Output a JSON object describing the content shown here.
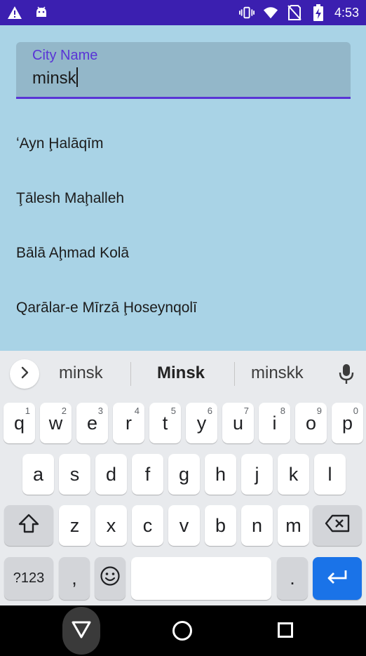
{
  "status_bar": {
    "time": "4:53",
    "icons_left": [
      "warning-icon",
      "android-icon"
    ],
    "icons_right": [
      "vibrate-icon",
      "wifi-icon",
      "no-sim-icon",
      "battery-charging-icon"
    ]
  },
  "city_input": {
    "label": "City Name",
    "value": "minsk"
  },
  "suggestions": [
    "ʻAyn Ḩalāqīm",
    "Ţālesh Maḩalleh",
    "Bālā Aḩmad Kolā",
    "Qarālar-e Mīrzā Ḩoseynqolī"
  ],
  "keyboard": {
    "word_suggestions": [
      "minsk",
      "Minsk",
      "minskk"
    ],
    "row1": [
      {
        "key": "q",
        "hint": "1"
      },
      {
        "key": "w",
        "hint": "2"
      },
      {
        "key": "e",
        "hint": "3"
      },
      {
        "key": "r",
        "hint": "4"
      },
      {
        "key": "t",
        "hint": "5"
      },
      {
        "key": "y",
        "hint": "6"
      },
      {
        "key": "u",
        "hint": "7"
      },
      {
        "key": "i",
        "hint": "8"
      },
      {
        "key": "o",
        "hint": "9"
      },
      {
        "key": "p",
        "hint": "0"
      }
    ],
    "row2": [
      "a",
      "s",
      "d",
      "f",
      "g",
      "h",
      "j",
      "k",
      "l"
    ],
    "row3": [
      "z",
      "x",
      "c",
      "v",
      "b",
      "n",
      "m"
    ],
    "symbols_label": "?123",
    "comma_label": ",",
    "period_label": "."
  },
  "colors": {
    "status_bar": "#3b1fb0",
    "app_background": "#a9d3e6",
    "accent": "#5a34d6",
    "enter_key": "#1a73e8"
  }
}
